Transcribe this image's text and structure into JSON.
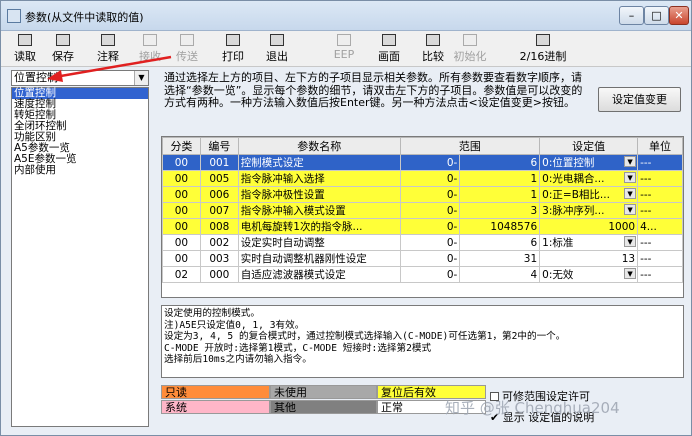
{
  "window": {
    "title": "参数(从文件中读取的值)"
  },
  "toolbar": [
    {
      "label": "读取",
      "enabled": true
    },
    {
      "label": "保存",
      "enabled": true
    },
    {
      "label": "注释",
      "enabled": true
    },
    {
      "label": "接收",
      "enabled": false
    },
    {
      "label": "传送",
      "enabled": false
    },
    {
      "label": "打印",
      "enabled": true
    },
    {
      "label": "退出",
      "enabled": true
    },
    {
      "label": "EEP",
      "enabled": false
    },
    {
      "label": "画面",
      "enabled": true
    },
    {
      "label": "比较",
      "enabled": true
    },
    {
      "label": "初始化",
      "enabled": false
    },
    {
      "label": "2/16进制",
      "enabled": true
    }
  ],
  "category_select": {
    "value": "位置控制"
  },
  "category_list": [
    "位置控制",
    "速度控制",
    "转矩控制",
    "全闭环控制",
    "功能区别",
    "A5参数一览",
    "A5E参数一览",
    "内部使用"
  ],
  "description": "通过选择左上方的项目、左下方的子项目显示相关参数。所有参数要查看数字顺序，请选择“参数一览”。显示每个参数的细节，请双击左下方的子项目。参数值是可以改变的方式有两种。一种方法输入数值后按Enter键。另一种方法点击<设定值变更>按钮。",
  "set_value_button": "设定值变更",
  "table": {
    "headers": [
      "分类",
      "编号",
      "参数名称",
      "范围",
      "",
      "设定值",
      "单位"
    ],
    "rows": [
      {
        "cat": "00",
        "no": "001",
        "name": "控制模式设定",
        "min": "0-",
        "max": "6",
        "value": "0:位置控制",
        "dropdown": true,
        "unit": "---",
        "style": "s"
      },
      {
        "cat": "00",
        "no": "005",
        "name": "指令脉冲输入选择",
        "min": "0-",
        "max": "1",
        "value": "0:光电耦合...",
        "dropdown": true,
        "unit": "---",
        "style": "y"
      },
      {
        "cat": "00",
        "no": "006",
        "name": "指令脉冲极性设置",
        "min": "0-",
        "max": "1",
        "value": "0:正=B相比...",
        "dropdown": true,
        "unit": "---",
        "style": "y"
      },
      {
        "cat": "00",
        "no": "007",
        "name": "指令脉冲输入模式设置",
        "min": "0-",
        "max": "3",
        "value": "3:脉冲序列...",
        "dropdown": true,
        "unit": "---",
        "style": "y"
      },
      {
        "cat": "00",
        "no": "008",
        "name": "电机每旋转1次的指令脉...",
        "min": "0-",
        "max": "1048576",
        "value": "1000",
        "dropdown": false,
        "unit": "4...",
        "style": "y"
      },
      {
        "cat": "00",
        "no": "002",
        "name": "设定实时自动调整",
        "min": "0-",
        "max": "6",
        "value": "1:标准",
        "dropdown": true,
        "unit": "---",
        "style": "w"
      },
      {
        "cat": "00",
        "no": "003",
        "name": "实时自动调整机器刚性设定",
        "min": "0-",
        "max": "31",
        "value": "13",
        "dropdown": false,
        "unit": "---",
        "style": "w"
      },
      {
        "cat": "02",
        "no": "000",
        "name": "自适应滤波器模式设定",
        "min": "0-",
        "max": "4",
        "value": "0:无效",
        "dropdown": true,
        "unit": "---",
        "style": "w"
      }
    ]
  },
  "note": "设定使用的控制模式。\n注)A5E只设定值0, 1, 3有效。\n设定为3, 4, 5 的复合模式时，通过控制模式选择输入(C-MODE)可任选第1，第2中的一个。\nC-MODE 开放时:选择第1模式，C-MODE 短接时:选择第2模式\n选择前后10ms之内请勿输入指令。",
  "legend": [
    {
      "label": "只读",
      "color": "#ff8c3a"
    },
    {
      "label": "未使用",
      "color": "#a8a8a8"
    },
    {
      "label": "复位后有效",
      "color": "#ffff38"
    },
    {
      "label": "系统",
      "color": "#ffb6c8"
    },
    {
      "label": "其他",
      "color": "#808080"
    },
    {
      "label": "正常",
      "color": "#ffffff"
    }
  ],
  "range_checkbox": "可修范围设定许可",
  "show_checkbox": "显示",
  "show_checkbox_rest": "设定值的说明",
  "watermark": "知乎 @张 Chenghua204",
  "colors": {
    "selected_row": "#2f63c8",
    "reset_valid": "#ffff38"
  }
}
